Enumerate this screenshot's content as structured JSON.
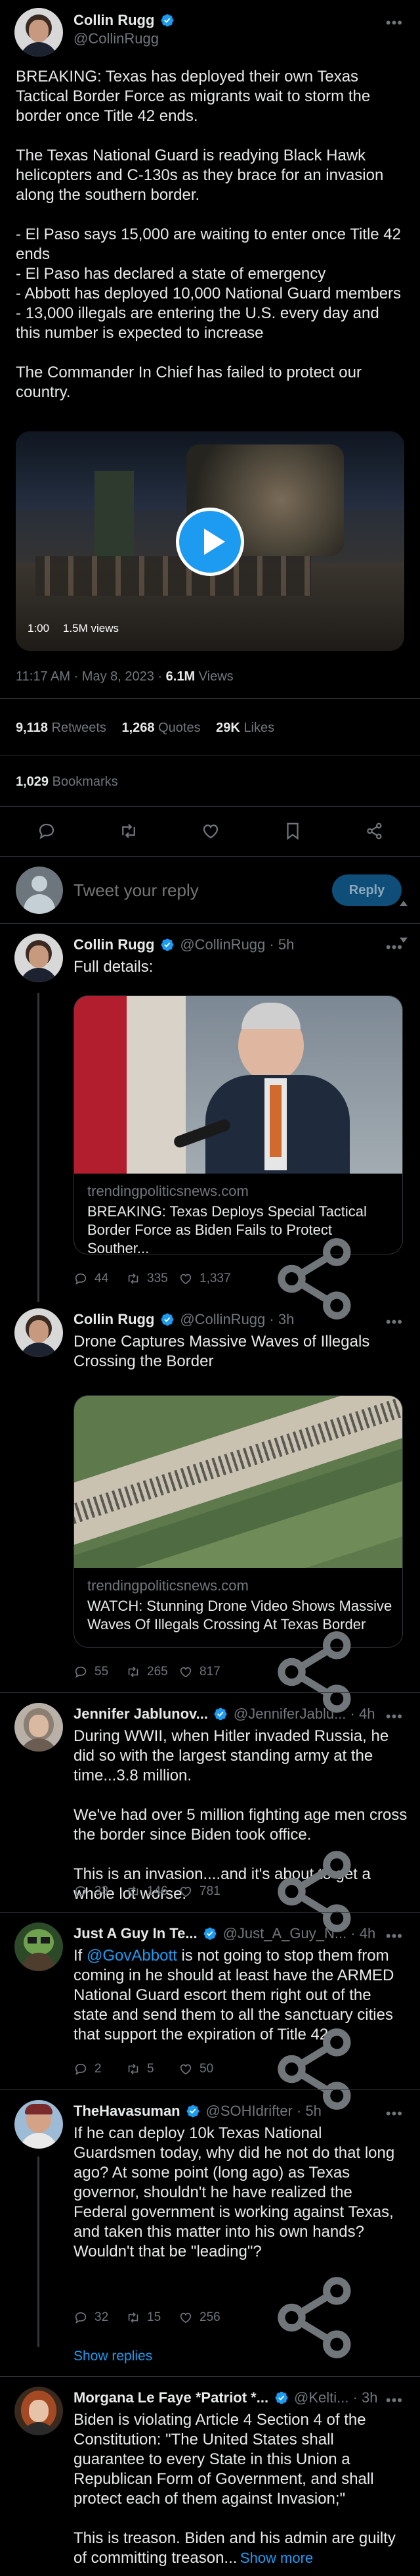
{
  "main_tweet": {
    "name": "Collin Rugg",
    "handle": "@CollinRugg",
    "text": "BREAKING: Texas has deployed their own Texas Tactical Border Force as migrants wait to storm the border once Title 42 ends.\n\nThe Texas National Guard is readying Black Hawk helicopters and C-130s as they brace for an invasion along the southern border.\n\n- El Paso says 15,000 are waiting to enter once Title 42 ends\n- El Paso has declared a state of emergency\n- Abbott has deployed 10,000 National Guard members\n- 13,000 illegals are entering the U.S. every day and this number is expected to increase\n\nThe Commander In Chief has failed to protect our country.",
    "video_time": "1:00",
    "video_views": "1.5M views",
    "time": "11:17 AM · May 8, 2023 ·",
    "views_count": "6.1M",
    "views_label": "Views",
    "retweets": "9,118",
    "retweets_label": "Retweets",
    "quotes": "1,268",
    "quotes_label": "Quotes",
    "likes": "29K",
    "likes_label": "Likes",
    "bookmarks": "1,029",
    "bookmarks_label": "Bookmarks"
  },
  "reply_box": {
    "placeholder": "Tweet your reply",
    "button": "Reply"
  },
  "replies": [
    {
      "name": "Collin Rugg",
      "handle": "@CollinRugg · 5h",
      "text": "Full details:",
      "card_domain": "trendingpoliticsnews.com",
      "card_title": "BREAKING: Texas Deploys Special Tactical\nBorder Force as Biden Fails to Protect Souther...",
      "replies": "44",
      "retweets": "335",
      "likes": "1,337"
    },
    {
      "name": "Collin Rugg",
      "handle": "@CollinRugg · 3h",
      "text": "Drone Captures Massive Waves of Illegals Crossing the Border",
      "card_domain": "trendingpoliticsnews.com",
      "card_title": "WATCH: Stunning Drone Video Shows Massive\nWaves Of Illegals Crossing At Texas Border",
      "replies": "55",
      "retweets": "265",
      "likes": "817"
    },
    {
      "name": "Jennifer Jablunov...",
      "handle": "@JenniferJablu... · 4h",
      "text": "During WWII, when Hitler invaded Russia, he did so with the largest standing army at the time...3.8 million.\n\nWe've had over 5 million fighting age men cross the border since Biden took office.\n\nThis is an invasion....and it's about to get a whole lot worse.",
      "replies": "33",
      "retweets": "146",
      "likes": "781"
    },
    {
      "name": "Just A Guy In Te...",
      "handle": "@Just_A_Guy_N... · 4h",
      "mention": "@GovAbbott",
      "text": " is not going to stop them from coming in he should at least have the ARMED National Guard escort them right out of the state and send them to all the sanctuary cities that support the expiration of Title 42.",
      "prefix": "If ",
      "replies": "2",
      "retweets": "5",
      "likes": "50"
    },
    {
      "name": "TheHavasuman",
      "handle": "@SOHIdrifter · 5h",
      "text": "If he can deploy 10k Texas National Guardsmen today, why did he not do that long ago? At some point (long ago) as Texas governor, shouldn't he have realized the Federal government is working against Texas, and taken this matter into his own hands? Wouldn't that be \"leading\"?",
      "replies": "32",
      "retweets": "15",
      "likes": "256",
      "show_replies": "Show replies"
    },
    {
      "name": "Morgana Le Faye *Patriot *...",
      "handle": "@Kelti... · 3h",
      "text": "Biden is violating Article 4 Section 4 of the Constitution: \"The United States shall guarantee to every State in this Union a Republican Form of Government, and shall protect each of them against Invasion;\"\n\nThis is treason.  Biden and his admin are guilty of committing treason...",
      "show_more": "Show more"
    }
  ],
  "colors": {
    "accent": "#1d9bf0",
    "verified": "#1d9bf0",
    "background": "#000000",
    "muted": "#71767b"
  }
}
